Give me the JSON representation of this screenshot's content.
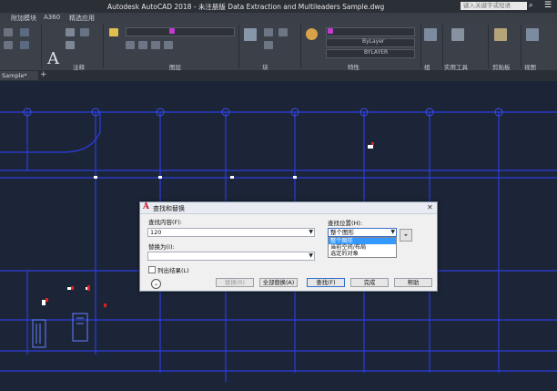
{
  "window": {
    "title": "Autodesk AutoCAD 2018 - 未注册版    Data Extraction and Multileaders Sample.dwg",
    "search_placeholder": "键入关键字或短语"
  },
  "ribbon_tabs": [
    "附加模块",
    "A360",
    "精选应用"
  ],
  "ribbon": {
    "panels": [
      "注释",
      "图层",
      "块",
      "特性",
      "组",
      "实用工具",
      "剪贴板",
      "视图"
    ],
    "bylayer_1": "ByLayer",
    "bylayer_2": "ByLayer",
    "bylayer_3": "BYLAYER"
  },
  "document_tab": "Sample*",
  "dialog": {
    "title": "查找和替换",
    "find_label": "查找内容(F):",
    "find_value": "120",
    "replace_label": "替换为(I):",
    "replace_value": "",
    "find_where_label": "查找位置(H):",
    "find_where_value": "整个图形",
    "find_where_options": [
      "整个图形",
      "当前空间/布局",
      "选定的对象"
    ],
    "list_results_label": "列出结果(L)",
    "buttons": {
      "replace": "替换(R)",
      "replace_all": "全部替换(A)",
      "find": "查找(F)",
      "done": "完成",
      "help": "帮助"
    }
  },
  "colors": {
    "accent_selection": "#3399ff",
    "highlight_frame": "#e0201d",
    "drawing_lines": "#2b3de0",
    "background": "#1c2537"
  }
}
